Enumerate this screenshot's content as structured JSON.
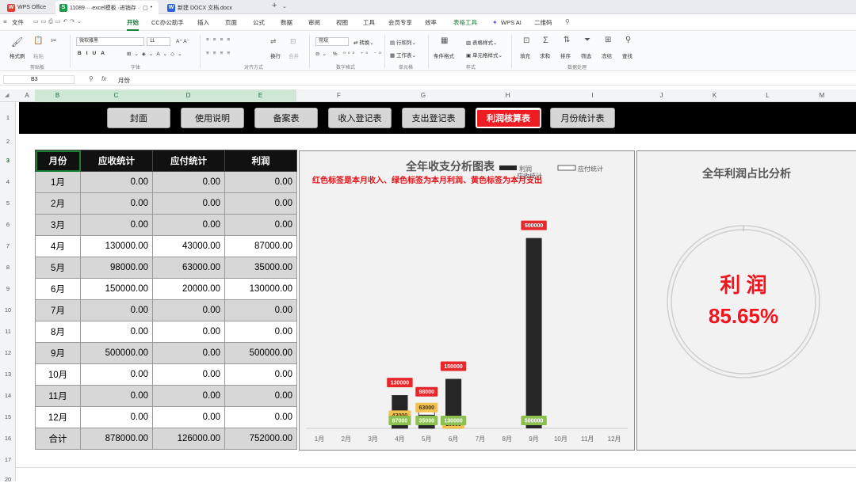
{
  "tabs": [
    {
      "label": "WPS Office",
      "icon": "wps-logo-icon"
    },
    {
      "label": "11089····excel模板 ·进销存 ·",
      "icon": "sheet-file-icon",
      "icon_text": "S"
    },
    {
      "label": "新建 DOCX 文档.docx",
      "icon": "doc-file-icon",
      "icon_text": "W"
    }
  ],
  "tab_add": "+",
  "menus": [
    "文件",
    "开始",
    "CC办公助手",
    "插入",
    "页面",
    "公式",
    "数据",
    "审阅",
    "视图",
    "工具",
    "会员专享",
    "效率",
    "表格工具",
    "WPS AI",
    "二维码"
  ],
  "active_menu": "开始",
  "ribbon": {
    "format_painter": "格式刷",
    "paste": "粘贴",
    "font_name": "微软雅黑",
    "font_size": "11",
    "number_format": "常规",
    "convert": "转换",
    "wrap": "换行",
    "merge": "合并",
    "row_col": "行和列",
    "worksheet": "工作表",
    "cond_format": "条件格式",
    "table_style": "表格样式",
    "cell_style": "单元格样式",
    "fill": "填充",
    "sum": "求和",
    "sort": "排序",
    "filter": "筛选",
    "freeze": "冻结",
    "find": "查找",
    "groups": [
      "剪贴板",
      "字体",
      "对齐方式",
      "数字格式",
      "单元格",
      "样式",
      "数据处理"
    ]
  },
  "formula_bar": {
    "cell_ref": "B3",
    "fx": "fx",
    "content": "月份"
  },
  "columns": [
    "A",
    "B",
    "C",
    "D",
    "E",
    "F",
    "G",
    "H",
    "I",
    "J",
    "K",
    "L",
    "M"
  ],
  "rows": [
    "1",
    "2",
    "3",
    "4",
    "5",
    "6",
    "7",
    "8",
    "9",
    "10",
    "11",
    "12",
    "13",
    "14",
    "15",
    "16",
    "17",
    "20"
  ],
  "nav_buttons": [
    "封面",
    "使用说明",
    "备案表",
    "收入登记表",
    "支出登记表",
    "利润核算表",
    "月份统计表"
  ],
  "active_nav": "利润核算表",
  "table": {
    "headers": [
      "月份",
      "应收统计",
      "应付统计",
      "利润"
    ],
    "rows": [
      [
        "1月",
        "0.00",
        "0.00",
        "0.00"
      ],
      [
        "2月",
        "0.00",
        "0.00",
        "0.00"
      ],
      [
        "3月",
        "0.00",
        "0.00",
        "0.00"
      ],
      [
        "4月",
        "130000.00",
        "43000.00",
        "87000.00"
      ],
      [
        "5月",
        "98000.00",
        "63000.00",
        "35000.00"
      ],
      [
        "6月",
        "150000.00",
        "20000.00",
        "130000.00"
      ],
      [
        "7月",
        "0.00",
        "0.00",
        "0.00"
      ],
      [
        "8月",
        "0.00",
        "0.00",
        "0.00"
      ],
      [
        "9月",
        "500000.00",
        "0.00",
        "500000.00"
      ],
      [
        "10月",
        "0.00",
        "0.00",
        "0.00"
      ],
      [
        "11月",
        "0.00",
        "0.00",
        "0.00"
      ],
      [
        "12月",
        "0.00",
        "0.00",
        "0.00"
      ],
      [
        "合计",
        "878000.00",
        "126000.00",
        "752000.00"
      ]
    ]
  },
  "chart_data": [
    {
      "type": "bar",
      "title": "全年收支分析图表",
      "subtitle": "红色标签是本月收入、绿色标签为本月利润、黄色标签为本月支出",
      "categories": [
        "1月",
        "2月",
        "3月",
        "4月",
        "5月",
        "6月",
        "7月",
        "8月",
        "9月",
        "10月",
        "11月",
        "12月"
      ],
      "series": [
        {
          "name": "利润",
          "values": [
            0,
            0,
            0,
            87000,
            35000,
            130000,
            0,
            0,
            500000,
            0,
            0,
            0
          ]
        },
        {
          "name": "应付统计",
          "values": [
            0,
            0,
            0,
            43000,
            63000,
            20000,
            0,
            0,
            0,
            0,
            0,
            0
          ]
        }
      ],
      "income": [
        0,
        0,
        0,
        130000,
        98000,
        150000,
        0,
        0,
        500000,
        0,
        0,
        0
      ],
      "income_labels": [
        "130000",
        "98000",
        "150000",
        "500000"
      ],
      "expense_labels": [
        "43000",
        "63000",
        "20000"
      ],
      "profit_labels": [
        "87000",
        "35000",
        "130000",
        "500000"
      ],
      "legend": [
        "利润",
        "应付统计",
        "应收统计"
      ],
      "legend_position": "top-right",
      "ylim": [
        0,
        520000
      ],
      "grid": false,
      "colors": {
        "profit": "#262626",
        "expense_fill": "#ffffff",
        "income_label": "#e8272b",
        "profit_label": "#8cc152",
        "expense_label": "#f2c14e"
      }
    },
    {
      "type": "pie",
      "title": "全年利润占比分析",
      "center_label": "利 润",
      "center_value": "85.65%",
      "value": 0.8565
    }
  ]
}
